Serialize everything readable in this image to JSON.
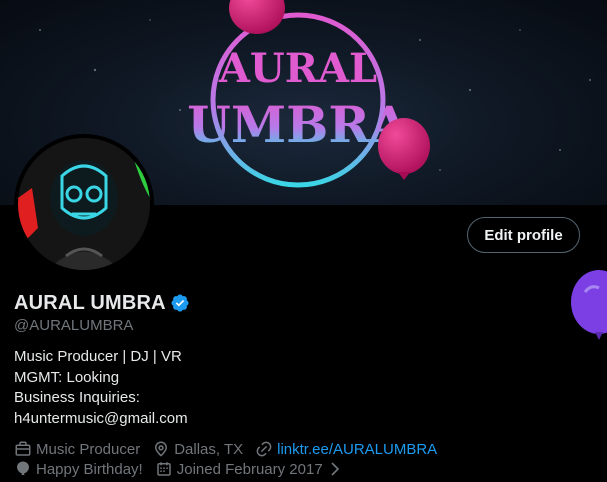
{
  "profile": {
    "display_name": "AURAL UMBRA",
    "handle": "@AURALUMBRA",
    "edit_button": "Edit profile",
    "bio_lines": [
      "Music Producer | DJ | VR",
      "MGMT: Looking",
      "Business Inquiries:",
      "h4untermusic@gmail.com"
    ],
    "category": "Music Producer",
    "location": "Dallas, TX",
    "link": "linktr.ee/AURALUMBRA",
    "birthday": "Happy Birthday!",
    "joined": "Joined February 2017"
  },
  "banner": {
    "logo_line1": "AURAL",
    "logo_line2": "UMBRA"
  },
  "icons": {
    "verified": "verified-badge-icon",
    "category": "briefcase-icon",
    "location": "location-pin-icon",
    "link": "link-icon",
    "birthday": "balloon-icon",
    "joined": "calendar-icon",
    "chevron": "chevron-right-icon"
  },
  "colors": {
    "accent": "#1d9bf0",
    "muted": "#71767b",
    "text": "#e7e9ea",
    "balloon_pink": "#d4106f",
    "balloon_purple": "#7b3fe4",
    "logo_pink": "#e05ad0",
    "logo_cyan": "#3ad6e6"
  }
}
